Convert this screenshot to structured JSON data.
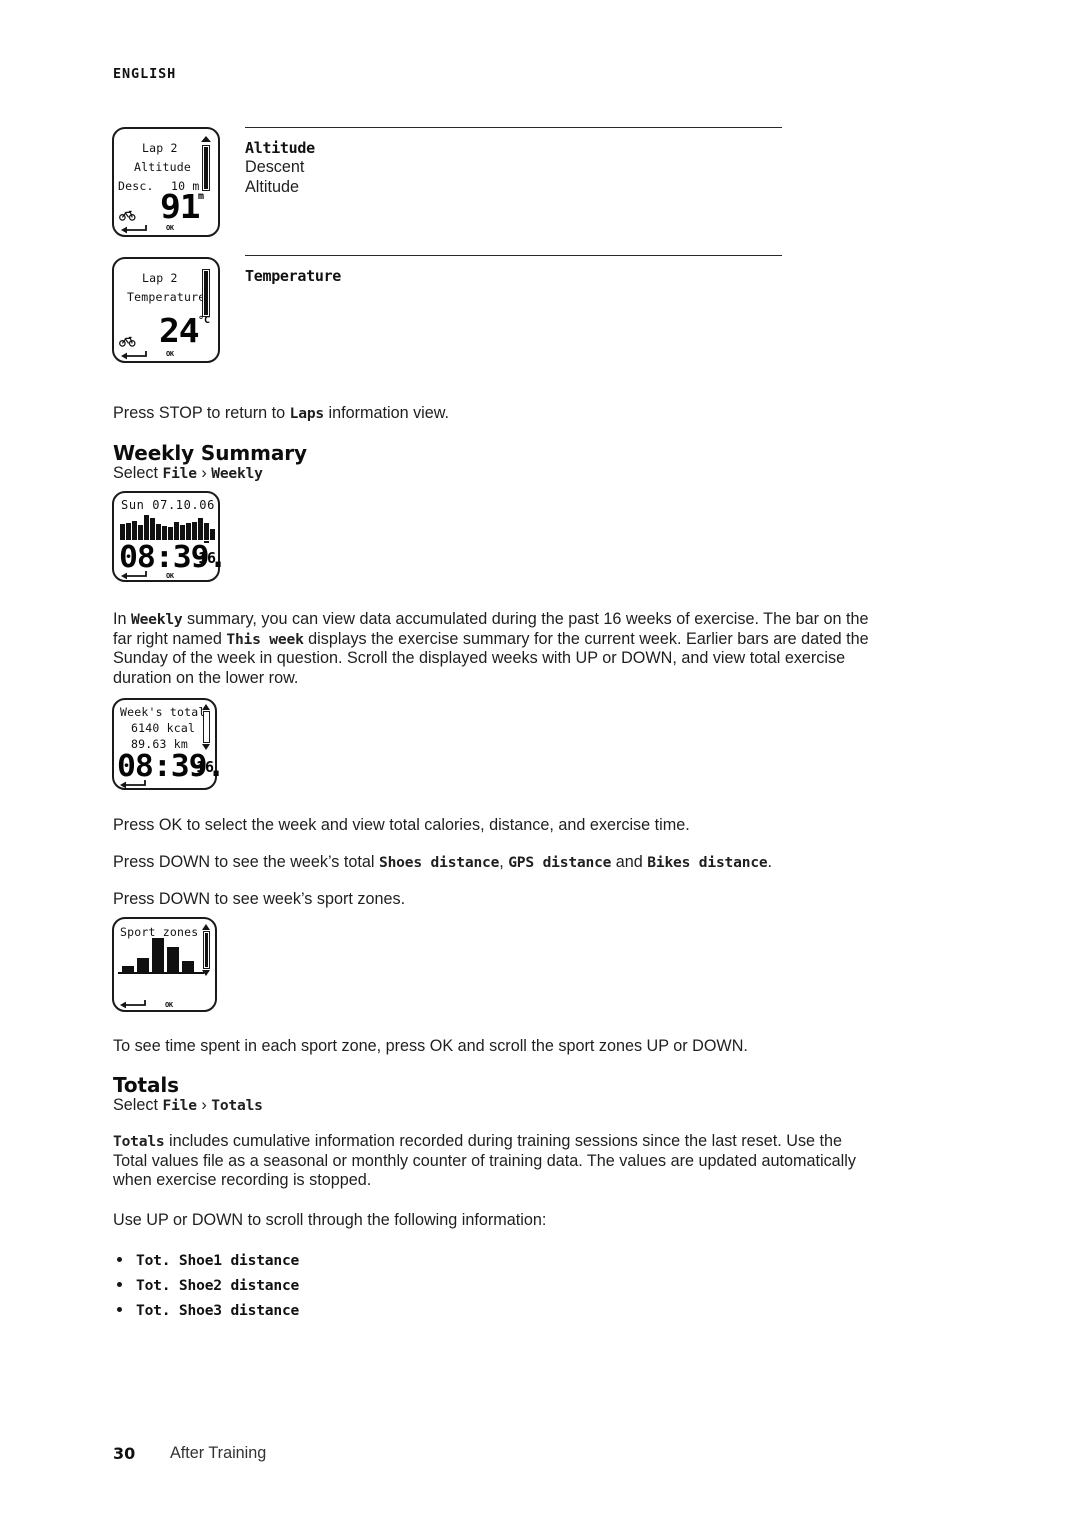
{
  "page": {
    "language_header": "ENGLISH",
    "footer_number": "30",
    "footer_label": "After Training"
  },
  "definitions": [
    {
      "title": "Altitude",
      "lines": [
        "Descent",
        "Altitude"
      ]
    },
    {
      "title": "Temperature",
      "lines": []
    }
  ],
  "devices": {
    "altitude": {
      "line1": "Lap 2",
      "line2": "Altitude",
      "label_left": "Desc.",
      "label_right": "10 m",
      "big_value": "91",
      "unit": "m",
      "ok_label": "OK"
    },
    "temperature": {
      "line1": "Lap 2",
      "line2": "Temperature",
      "big_value": "24",
      "unit": "°C",
      "ok_label": "OK"
    },
    "weekly": {
      "header": "Sun 07.10.06",
      "big_value": "08:39.",
      "small_value": "16",
      "ok_label": "OK"
    },
    "weeks_total": {
      "line1": "Week's total",
      "line2": "6140 kcal",
      "line3": "89.63 km",
      "big_value": "08:39.",
      "small_value": "16"
    },
    "sport_zones": {
      "header": "Sport zones",
      "ok_label": "OK"
    }
  },
  "chart_data": [
    {
      "type": "bar",
      "title": "Sun 07.10.06",
      "xlabel": "",
      "ylabel": "",
      "categories": [
        "1",
        "2",
        "3",
        "4",
        "5",
        "6",
        "7",
        "8",
        "9",
        "10",
        "11",
        "12",
        "13",
        "14",
        "15",
        "16"
      ],
      "values": [
        60,
        66,
        72,
        58,
        96,
        86,
        62,
        54,
        52,
        70,
        58,
        64,
        70,
        84,
        64,
        44
      ],
      "ylim": [
        0,
        100
      ],
      "grid": false,
      "legend": "none"
    },
    {
      "type": "bar",
      "title": "Sport zones",
      "xlabel": "",
      "ylabel": "",
      "categories": [
        "1",
        "2",
        "3",
        "4",
        "5"
      ],
      "values": [
        18,
        42,
        100,
        72,
        34
      ],
      "ylim": [
        0,
        100
      ],
      "grid": false,
      "legend": "none"
    }
  ],
  "text": {
    "press_stop": {
      "pre": "Press STOP to return to ",
      "bold": "Laps",
      "post": " information view."
    },
    "weekly_summary_heading": "Weekly Summary",
    "weekly_select": {
      "pre": "Select ",
      "b1": "File",
      "sep": " › ",
      "b2": "Weekly"
    },
    "weekly_para": {
      "l1_a": "In ",
      "l1_b": "Weekly",
      "l1_c": " summary, you can view data accumulated during the past 16 weeks of exercise. The bar on the",
      "l2_a": "far right named ",
      "l2_b": "This week",
      "l2_c": " displays the exercise summary for the current week. Earlier bars are dated the",
      "l3": "Sunday of the week in question. Scroll the displayed weeks with UP or DOWN, and view total exercise",
      "l4": "duration on the lower row."
    },
    "press_ok_week": "Press OK to select the week and view total calories, distance, and exercise time.",
    "press_down_distances": {
      "pre": "Press DOWN to see the week’s total ",
      "b1": "Shoes distance",
      "mid1": ", ",
      "b2": "GPS distance",
      "mid2": " and ",
      "b3": "Bikes distance",
      "post": "."
    },
    "press_down_zones": "Press DOWN to see week’s sport zones.",
    "sport_zones_note": "To see time spent in each sport zone, press OK and scroll the sport zones UP or DOWN.",
    "totals_heading": "Totals",
    "totals_select": {
      "pre": "Select ",
      "b1": "File",
      "sep": " › ",
      "b2": "Totals"
    },
    "totals_para": {
      "l1_b": "Totals",
      "l1_c": " includes cumulative information recorded during training sessions since the last reset. Use the",
      "l2": "Total values file as a seasonal or monthly counter of training data. The values are updated automatically",
      "l3": "when exercise recording is stopped."
    },
    "use_up_down": "Use UP or DOWN to scroll through the following information:",
    "bullets": [
      "Tot. Shoe1 distance",
      "Tot. Shoe2 distance",
      "Tot. Shoe3 distance"
    ]
  }
}
